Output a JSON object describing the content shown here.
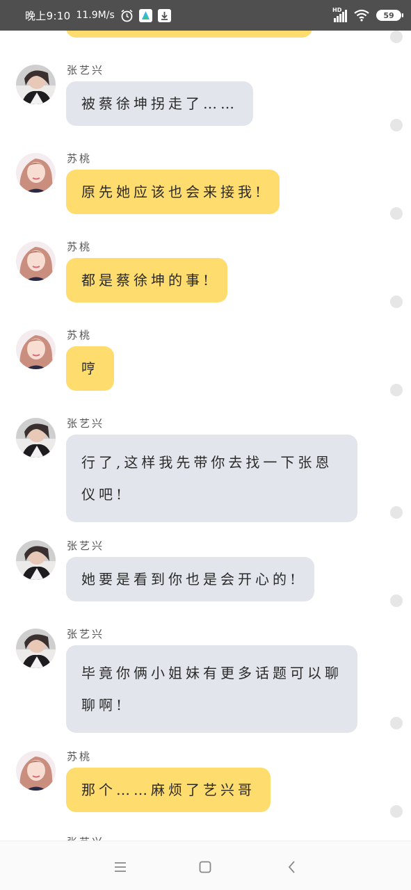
{
  "status_bar": {
    "time": "晚上9:10",
    "speed": "11.9M/s",
    "network": "HD",
    "battery": "59"
  },
  "messages": [
    {
      "sender": "张艺兴",
      "text": "被蔡徐坤拐走了……",
      "side": "gray"
    },
    {
      "sender": "苏桃",
      "text": "原先她应该也会来接我!",
      "side": "yellow"
    },
    {
      "sender": "苏桃",
      "text": "都是蔡徐坤的事!",
      "side": "yellow"
    },
    {
      "sender": "苏桃",
      "text": "哼",
      "side": "yellow"
    },
    {
      "sender": "张艺兴",
      "text": "行了,这样我先带你去找一下张恩仪吧!",
      "side": "gray"
    },
    {
      "sender": "张艺兴",
      "text": "她要是看到你也是会开心的!",
      "side": "gray"
    },
    {
      "sender": "张艺兴",
      "text": "毕竟你俩小姐妹有更多话题可以聊聊啊!",
      "side": "gray"
    },
    {
      "sender": "苏桃",
      "text": "那个……麻烦了艺兴哥",
      "side": "yellow"
    }
  ],
  "partial_next_sender": "张艺兴",
  "icons": {
    "alarm": "alarm-clock-icon",
    "app": "app-icon",
    "download": "download-icon",
    "signal": "signal-icon",
    "wifi": "wifi-icon",
    "battery": "battery-icon",
    "menu": "menu-icon",
    "home": "home-icon",
    "back": "back-icon"
  },
  "colors": {
    "status_bar": "#4f4f4f",
    "bubble_yellow": "#ffdc6e",
    "bubble_gray": "#e2e6ec"
  }
}
